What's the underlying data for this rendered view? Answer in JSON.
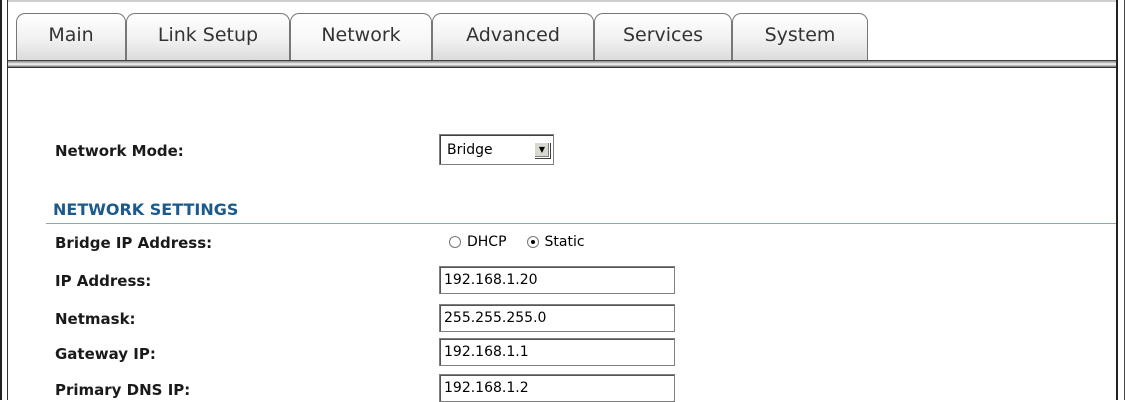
{
  "tabs": [
    {
      "label": "Main",
      "active": false
    },
    {
      "label": "Link Setup",
      "active": false
    },
    {
      "label": "Network",
      "active": true
    },
    {
      "label": "Advanced",
      "active": false
    },
    {
      "label": "Services",
      "active": false
    },
    {
      "label": "System",
      "active": false
    }
  ],
  "network_mode": {
    "label": "Network Mode:",
    "selected": "Bridge",
    "dropdown_icon": "triangle-down-icon"
  },
  "network_settings": {
    "title": "NETWORK SETTINGS",
    "bridge_ip": {
      "label": "Bridge IP Address:",
      "options": [
        {
          "label": "DHCP",
          "checked": false
        },
        {
          "label": "Static",
          "checked": true
        }
      ]
    },
    "ip_address": {
      "label": "IP Address:",
      "value": "192.168.1.20"
    },
    "netmask": {
      "label": "Netmask:",
      "value": "255.255.255.0"
    },
    "gateway": {
      "label": "Gateway IP:",
      "value": "192.168.1.1"
    },
    "primary_dns": {
      "label": "Primary DNS IP:",
      "value": "192.168.1.2"
    }
  },
  "colors": {
    "section_title": "#1d5a8c",
    "label_text": "#1a1a1a"
  }
}
